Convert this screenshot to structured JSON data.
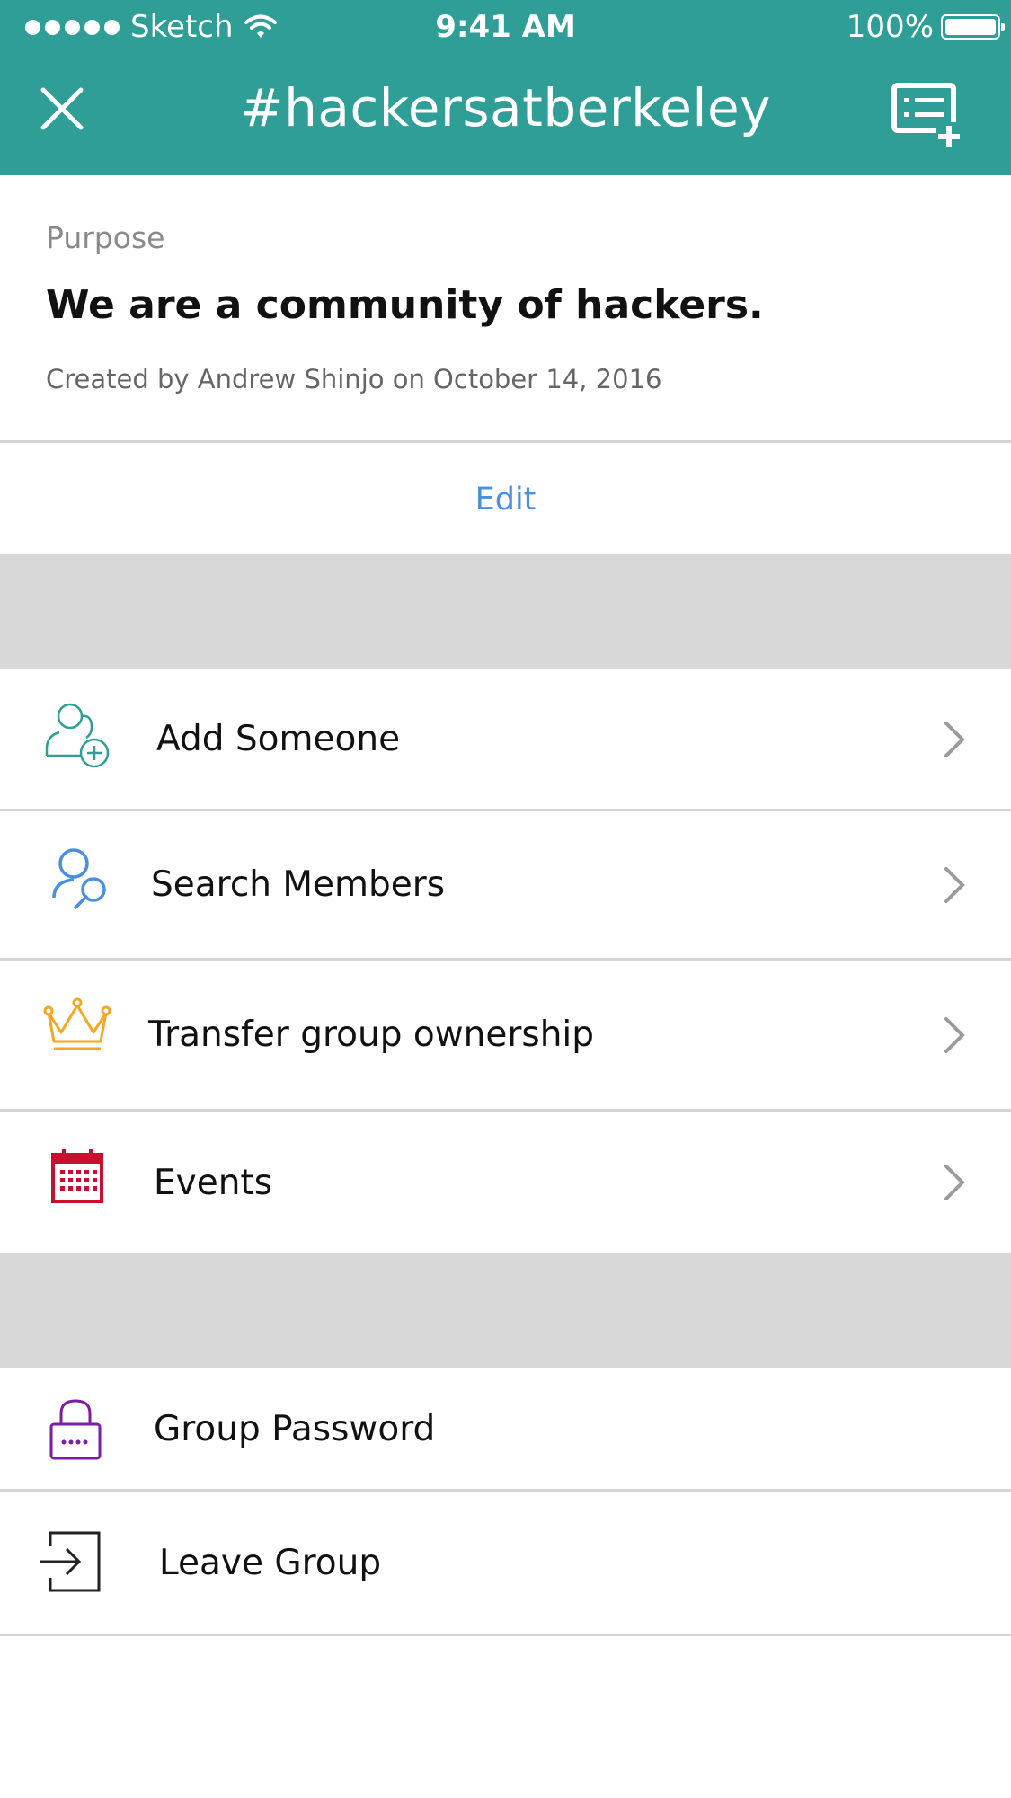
{
  "status_bar": {
    "carrier": "Sketch",
    "time": "9:41 AM",
    "battery": "100%"
  },
  "header": {
    "title": "#hackersatberkeley",
    "accent_color": "#2e9e96"
  },
  "purpose": {
    "label": "Purpose",
    "text": "We are a community of hackers.",
    "meta": "Created by Andrew Shinjo on October 14, 2016",
    "edit_label": "Edit"
  },
  "menu": {
    "add_someone": {
      "label": "Add Someone",
      "icon": "add-person-icon",
      "color": "#2e9e96"
    },
    "search_members": {
      "label": "Search Members",
      "icon": "search-person-icon",
      "color": "#4a90e2"
    },
    "transfer": {
      "label": "Transfer group ownership",
      "icon": "crown-icon",
      "color": "#f5a623"
    },
    "events": {
      "label": "Events",
      "icon": "calendar-icon",
      "color": "#c8102e"
    }
  },
  "settings": {
    "password": {
      "label": "Group Password",
      "icon": "lock-icon",
      "color": "#7b1fa2"
    },
    "leave": {
      "label": "Leave Group",
      "icon": "exit-icon",
      "color": "#222222"
    }
  }
}
